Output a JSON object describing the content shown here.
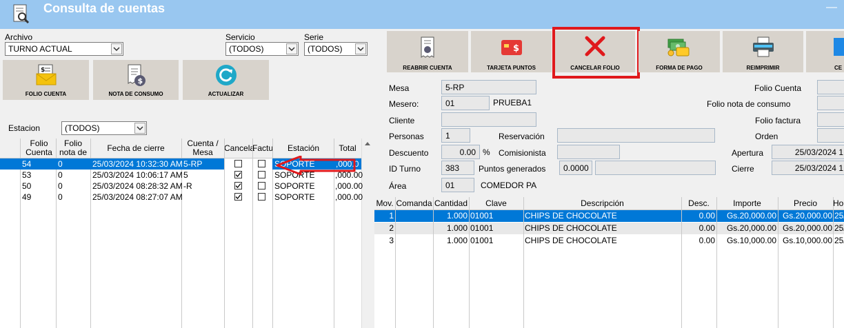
{
  "window": {
    "title": "Consulta de cuentas",
    "icon": "search-document-icon"
  },
  "filters": {
    "archivo_label": "Archivo",
    "archivo_value": "TURNO ACTUAL",
    "servicio_label": "Servicio",
    "servicio_value": "(TODOS)",
    "serie_label": "Serie",
    "serie_value": "(TODOS)",
    "estacion_label": "Estacion",
    "estacion_value": "(TODOS)"
  },
  "left_buttons": [
    {
      "label": "FOLIO CUENTA",
      "icon": "invoice-envelope-icon"
    },
    {
      "label": "NOTA DE CONSUMO",
      "icon": "receipt-dollar-icon"
    },
    {
      "label": "ACTUALIZAR",
      "icon": "refresh-icon"
    }
  ],
  "right_buttons": [
    {
      "label": "REABRIR CUENTA",
      "icon": "receipt-reopen-icon"
    },
    {
      "label": "TARJETA PUNTOS",
      "icon": "points-card-icon"
    },
    {
      "label": "CANCELAR FOLIO",
      "icon": "cancel-x-icon"
    },
    {
      "label": "FORMA DE PAGO",
      "icon": "payment-cash-icon"
    },
    {
      "label": "REIMPRIMIR",
      "icon": "printer-icon"
    },
    {
      "label": "CE",
      "icon": "close-icon"
    }
  ],
  "accounts_table": {
    "headers": {
      "folio_cuenta": "Folio Cuenta",
      "folio_nota": "Folio nota de",
      "fecha": "Fecha de cierre",
      "cuenta": "Cuenta / Mesa",
      "cancela": "Cancela",
      "factura": "Factur",
      "estacion": "Estación",
      "total": "Total"
    },
    "rows": [
      {
        "folio": "54",
        "nota": "0",
        "fecha": "25/03/2024 10:32:30 AM",
        "cuenta": "5-RP",
        "cancela": false,
        "factura": false,
        "estacion": "SOPORTE",
        "total": ",000.0"
      },
      {
        "folio": "53",
        "nota": "0",
        "fecha": "25/03/2024 10:06:17 AM",
        "cuenta": "5",
        "cancela": true,
        "factura": false,
        "estacion": "SOPORTE",
        "total": ",000.00"
      },
      {
        "folio": "50",
        "nota": "0",
        "fecha": "25/03/2024 08:28:32 AM",
        "cuenta": "-R",
        "cancela": true,
        "factura": false,
        "estacion": "SOPORTE",
        "total": ",000.00"
      },
      {
        "folio": "49",
        "nota": "0",
        "fecha": "25/03/2024 08:27:07 AM",
        "cuenta": "",
        "cancela": true,
        "factura": false,
        "estacion": "SOPORTE",
        "total": ",000.00"
      }
    ]
  },
  "details": {
    "mesa_label": "Mesa",
    "mesa_value": "5-RP",
    "mesero_label": "Mesero:",
    "mesero_value": "01",
    "mesero_name": "PRUEBA1",
    "cliente_label": "Cliente",
    "cliente_value": "",
    "personas_label": "Personas",
    "personas_value": "1",
    "reservacion_label": "Reservación",
    "reservacion_value": "",
    "descuento_label": "Descuento",
    "descuento_value": "0.00",
    "descuento_unit": "%",
    "comisionista_label": "Comisionista",
    "comisionista_value": "",
    "id_turno_label": "ID Turno",
    "id_turno_value": "383",
    "puntos_label": "Puntos generados",
    "puntos_value": "0.0000",
    "puntos_extra": "",
    "area_label": "Área",
    "area_value": "01",
    "area_name": "COMEDOR PA",
    "folio_cuenta_label": "Folio Cuenta",
    "folio_cuenta_value": "",
    "folio_nota_label": "Folio nota de consumo",
    "folio_nota_value": "",
    "folio_factura_label": "Folio factura",
    "folio_factura_value": "",
    "orden_label": "Orden",
    "orden_value": "",
    "apertura_label": "Apertura",
    "apertura_value": "25/03/2024 1",
    "cierre_label": "Cierre",
    "cierre_value": "25/03/2024 1"
  },
  "items_table": {
    "headers": {
      "mov": "Mov.",
      "comanda": "Comanda",
      "cantidad": "Cantidad",
      "clave": "Clave",
      "descripcion": "Descripción",
      "desc": "Desc.",
      "importe": "Importe",
      "precio": "Precio",
      "hora": "Hor"
    },
    "rows": [
      {
        "mov": "1",
        "comanda": "",
        "cantidad": "1.000",
        "clave": "01001",
        "descripcion": "CHIPS DE CHOCOLATE",
        "desc": "0.00",
        "importe": "Gs.20,000.00",
        "precio": "Gs.20,000.00",
        "hora": "25/"
      },
      {
        "mov": "2",
        "comanda": "",
        "cantidad": "1.000",
        "clave": "01001",
        "descripcion": "CHIPS DE CHOCOLATE",
        "desc": "0.00",
        "importe": "Gs.20,000.00",
        "precio": "Gs.20,000.00",
        "hora": "25/"
      },
      {
        "mov": "3",
        "comanda": "",
        "cantidad": "1.000",
        "clave": "01001",
        "descripcion": "CHIPS DE CHOCOLATE",
        "desc": "0.00",
        "importe": "Gs.10,000.00",
        "precio": "Gs.10,000.00",
        "hora": "25/"
      }
    ]
  },
  "colors": {
    "titlebar": "#99c7f0",
    "selection": "#0078d7",
    "highlight_box": "#e0191c",
    "arrow": "#e0191c"
  }
}
